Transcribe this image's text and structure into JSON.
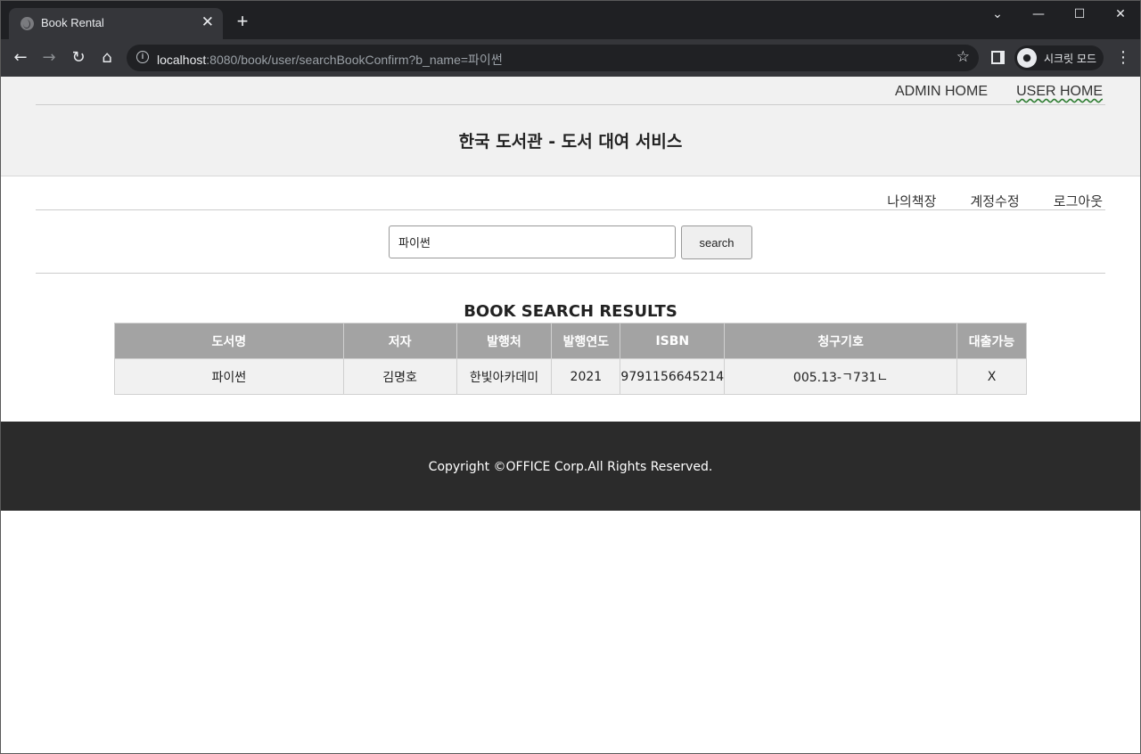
{
  "browser": {
    "tab_title": "Book Rental",
    "tab_close": "✕",
    "new_tab": "+",
    "url_host": "localhost",
    "url_rest": ":8080/book/user/searchBookConfirm?b_name=파이썬",
    "profile_label": "시크릿 모드",
    "window_controls": [
      "⌄",
      "—",
      "☐",
      "✕"
    ]
  },
  "header": {
    "admin_links": [
      "ADMIN HOME",
      "USER HOME"
    ],
    "site_title": "한국 도서관 - 도서 대여 서비스"
  },
  "user_nav": [
    "나의책장",
    "계정수정",
    "로그아웃"
  ],
  "search": {
    "value": "파이썬",
    "button_label": "search"
  },
  "results": {
    "title": "BOOK SEARCH RESULTS",
    "columns": [
      "도서명",
      "저자",
      "발행처",
      "발행연도",
      "ISBN",
      "청구기호",
      "대출가능"
    ],
    "rows": [
      [
        "파이썬",
        "김명호",
        "한빛아카데미",
        "2021",
        "9791156645214",
        "005.13-ㄱ731ㄴ",
        "X"
      ]
    ]
  },
  "footer": {
    "copyright": "Copyright ©OFFICE Corp.All Rights Reserved."
  },
  "colors": {
    "header_bg": "#f1f1f1",
    "table_header_bg": "#a3a3a3",
    "footer_bg": "#2b2b2b",
    "browser_dark": "#1f2023"
  }
}
